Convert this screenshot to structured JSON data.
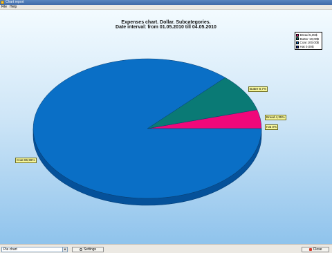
{
  "window": {
    "title": "Chart report"
  },
  "menu": {
    "items": [
      "File",
      "Help"
    ]
  },
  "chart_data": {
    "type": "pie",
    "title": "Expenses chart. Dollar. Subcategories.",
    "subtitle": "Date interval: from 01.05.2010 till 04.05.2010",
    "currency_symbol": "$",
    "slices": [
      {
        "name": "Bread",
        "value": 5.0,
        "percent": 4.35,
        "color": "#f0087a",
        "legend_label": "Bread 5,00$",
        "data_label": "Bread 4,35%"
      },
      {
        "name": "Butter",
        "value": 10.0,
        "percent": 8.7,
        "color": "#0a7a75",
        "legend_label": "Butter 10,00$",
        "data_label": "Butter 8,7%"
      },
      {
        "name": "Coat",
        "value": 100.0,
        "percent": 86.96,
        "color": "#0a6fc6",
        "legend_label": "Coat 100,00$",
        "data_label": "Coat 86,96%"
      },
      {
        "name": "Hat",
        "value": 0.0,
        "percent": 0,
        "color": "#142a9c",
        "legend_label": "Hat 0,00$",
        "data_label": "Hat 0%"
      }
    ],
    "legend_position": "top-right",
    "style": "3d"
  },
  "toolbar": {
    "chart_type_value": "Pie chart",
    "settings_label": "Settings",
    "close_label": "Close"
  },
  "colors": {
    "background_top": "#f3fbff",
    "background_bottom": "#8fc3ec",
    "pie_side": "#05519a"
  }
}
